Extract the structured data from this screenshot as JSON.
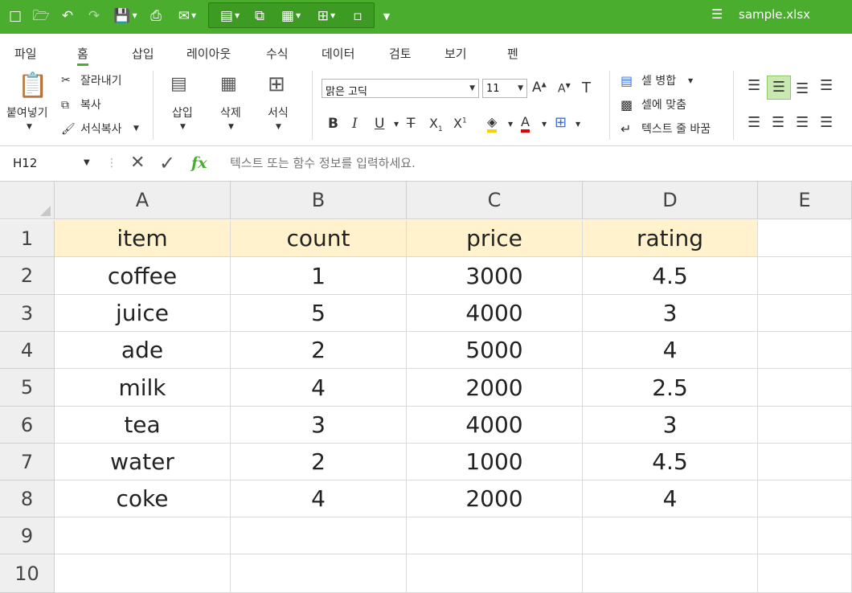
{
  "titlebar": {
    "filename": "sample.xlsx"
  },
  "menu": {
    "items": [
      "파일",
      "홈",
      "삽입",
      "레이아웃",
      "수식",
      "데이터",
      "검토",
      "보기",
      "펜"
    ],
    "active": "홈"
  },
  "ribbon": {
    "paste": "붙여넣기",
    "cut": "잘라내기",
    "copy": "복사",
    "format_painter": "서식복사",
    "insert": "삽입",
    "delete": "삭제",
    "format": "서식",
    "font_name": "맑은 고딕",
    "font_size": "11",
    "merge_cells": "셀 병합",
    "fit_to_cell": "셀에 맞춤",
    "wrap_text": "텍스트 줄 바꿈"
  },
  "formula_bar": {
    "name_box": "H12",
    "placeholder": "텍스트 또는 함수 정보를 입력하세요."
  },
  "sheet": {
    "columns": [
      "A",
      "B",
      "C",
      "D",
      "E"
    ],
    "rows": [
      "1",
      "2",
      "3",
      "4",
      "5",
      "6",
      "7",
      "8",
      "9",
      "10"
    ],
    "cells": [
      [
        "item",
        "count",
        "price",
        "rating"
      ],
      [
        "coffee",
        "1",
        "3000",
        "4.5"
      ],
      [
        "juice",
        "5",
        "4000",
        "3"
      ],
      [
        "ade",
        "2",
        "5000",
        "4"
      ],
      [
        "milk",
        "4",
        "2000",
        "2.5"
      ],
      [
        "tea",
        "3",
        "4000",
        "3"
      ],
      [
        "water",
        "2",
        "1000",
        "4.5"
      ],
      [
        "coke",
        "4",
        "2000",
        "4"
      ],
      [
        "",
        "",
        "",
        ""
      ],
      [
        "",
        "",
        "",
        ""
      ]
    ]
  },
  "colors": {
    "accent": "#4aad2e",
    "header_fill": "#fff2cc"
  }
}
